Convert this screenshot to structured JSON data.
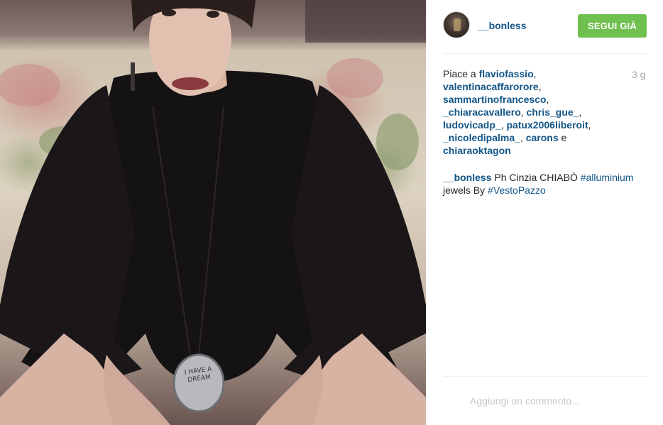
{
  "post": {
    "username": "__bonless",
    "follow_label": "SEGUI GIÀ",
    "time_ago": "3 g",
    "likes": {
      "prefix": "Piace a",
      "users": [
        "flaviofassio",
        "valentinacaffarorore",
        "sammartinofrancesco",
        "_chiaracavallero",
        "chris_gue_",
        "ludovicadp_",
        "patux2006liberoit",
        "_nicoledipalma_",
        "carons"
      ],
      "conjunction": "e",
      "last_user": "chiaraoktagon"
    },
    "caption": {
      "author": "__bonless",
      "text_1": "Ph Cinzia CHIABÒ",
      "tag_1": "#alluminium",
      "text_2": "jewels By",
      "tag_2": "#VestoPazzo"
    },
    "photo_inscription": "I HAVE A DREAM",
    "comment_placeholder": "Aggiungi un commento..."
  },
  "colors": {
    "link": "#125688",
    "follow_button": "#70c050",
    "timestamp": "#a5a7aa",
    "placeholder": "#c7c7c7",
    "divider": "#efefef"
  },
  "icons": {
    "avatar": "profile-photo"
  }
}
